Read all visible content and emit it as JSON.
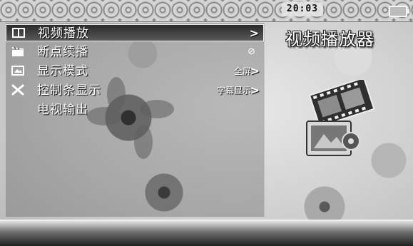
{
  "status_bar": {
    "time": "20:03"
  },
  "app": {
    "title": "视频播放器"
  },
  "menu": {
    "items": [
      {
        "label": "视频播放",
        "icon": "video-icon",
        "value": "",
        "arrow": ">",
        "selected": true
      },
      {
        "label": "断点续播",
        "icon": "clapperboard-icon",
        "value": "",
        "status": "⊘",
        "selected": false
      },
      {
        "label": "显示模式",
        "icon": "display-icon",
        "value": "全屏",
        "arrow": ">",
        "selected": false
      },
      {
        "label": "控制条显示",
        "icon": "tools-icon",
        "value": "字幕显示",
        "arrow": ">",
        "selected": false
      },
      {
        "label": "电视输出",
        "icon": "",
        "value": "",
        "selected": false
      }
    ]
  },
  "colors": {
    "highlight": "#3a3a3a",
    "text": "#ffffff"
  }
}
